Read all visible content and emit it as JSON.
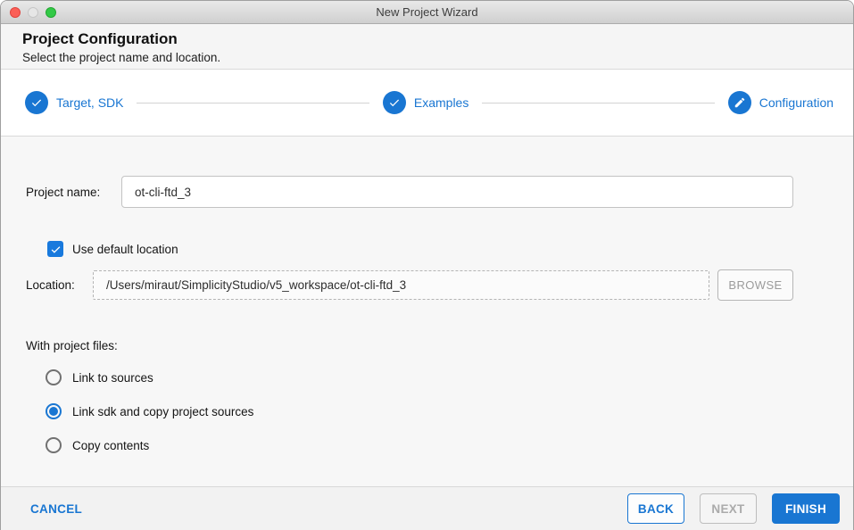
{
  "window": {
    "title": "New Project Wizard"
  },
  "header": {
    "title": "Project Configuration",
    "subtitle": "Select the project name and location."
  },
  "stepper": {
    "steps": [
      {
        "label": "Target, SDK",
        "icon": "check-icon",
        "state": "complete"
      },
      {
        "label": "Examples",
        "icon": "check-icon",
        "state": "complete"
      },
      {
        "label": "Configuration",
        "icon": "pencil-icon",
        "state": "current"
      }
    ]
  },
  "form": {
    "project_name": {
      "label": "Project name:",
      "value": "ot-cli-ftd_3"
    },
    "use_default_location": {
      "label": "Use default location",
      "checked": true
    },
    "location": {
      "label": "Location:",
      "value": "/Users/miraut/SimplicityStudio/v5_workspace/ot-cli-ftd_3",
      "browse_label": "BROWSE"
    },
    "with_project_files": {
      "label": "With project files:",
      "options": [
        {
          "label": "Link to sources",
          "selected": false
        },
        {
          "label": "Link sdk and copy project sources",
          "selected": true
        },
        {
          "label": "Copy contents",
          "selected": false
        }
      ]
    }
  },
  "footer": {
    "cancel_label": "CANCEL",
    "back_label": "BACK",
    "next_label": "NEXT",
    "finish_label": "FINISH"
  },
  "colors": {
    "accent": "#1976d2",
    "checkbox_blue": "#1879dd",
    "titlebar_close": "#fb5f57",
    "titlebar_minimize": "#e6e6e6",
    "titlebar_zoom": "#32c946"
  }
}
